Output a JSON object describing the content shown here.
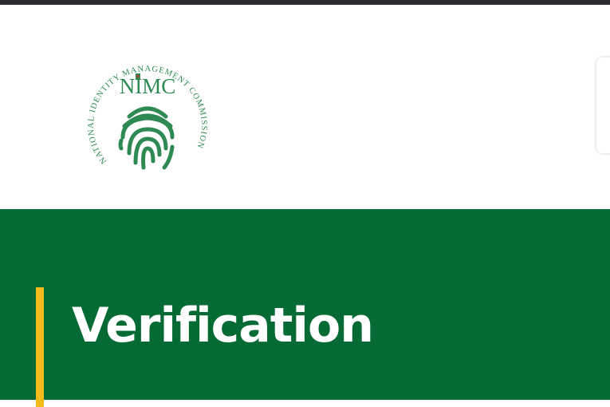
{
  "header": {
    "logo": {
      "abbreviation": "NIMC",
      "ring_text": "NATIONAL IDENTITY MANAGEMENT COMMISSION",
      "icon": "fingerprint-icon",
      "brand_color": "#2e8a52"
    }
  },
  "hero": {
    "title": "Verification",
    "background_color": "#066a35",
    "accent_color": "#f3bb1c"
  }
}
